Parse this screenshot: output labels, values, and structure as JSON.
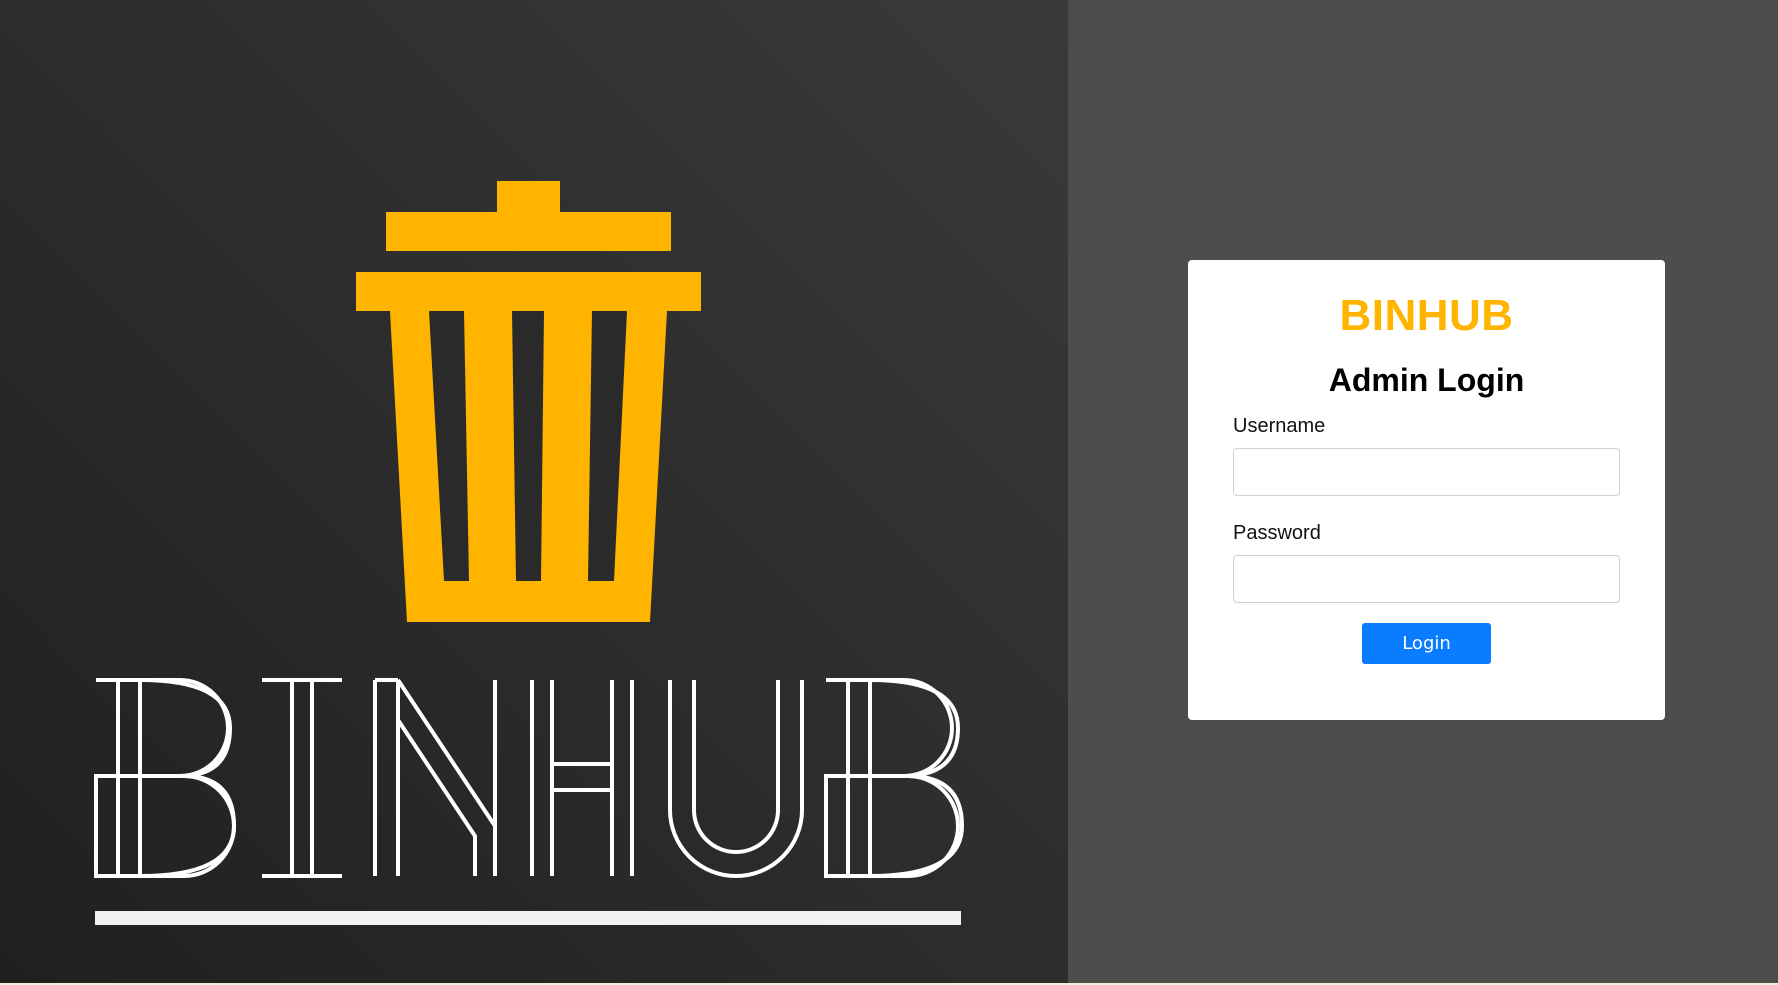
{
  "left_panel": {
    "logo_text": "BINHUB",
    "accent_color": "#ffb400"
  },
  "login": {
    "brand": "BINHUB",
    "title": "Admin Login",
    "username_label": "Username",
    "username_value": "",
    "password_label": "Password",
    "password_value": "",
    "button_label": "Login",
    "button_color": "#0a7cff"
  }
}
